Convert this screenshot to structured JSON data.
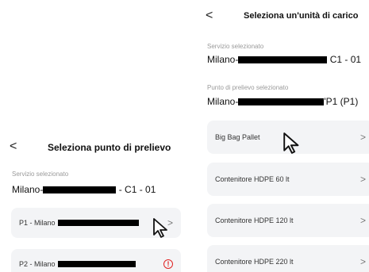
{
  "left": {
    "title": "Seleziona punto di prelievo",
    "back_glyph": "<",
    "service": {
      "label": "Servizio selezionato",
      "value_prefix": "Milano-",
      "value_suffix": " - C1 - 01"
    },
    "items": [
      {
        "label": "P1 - Milano",
        "chevron": ">"
      },
      {
        "label": "P2 - Milano",
        "alert": "!"
      }
    ]
  },
  "right": {
    "title": "Seleziona un'unità di carico",
    "back_glyph": "<",
    "service": {
      "label": "Servizio selezionato",
      "value_prefix": "Milano-",
      "value_suffix": " C1 - 01"
    },
    "pickup": {
      "label": "Punto di prelievo selezionato",
      "value_prefix": "Milano-",
      "value_suffix": "'P1 (P1)"
    },
    "items": [
      {
        "label": "Big Bag Pallet",
        "chevron": ">"
      },
      {
        "label": "Contenitore HDPE 60 lt",
        "chevron": ">"
      },
      {
        "label": "Contenitore HDPE 120 lt",
        "chevron": ">"
      },
      {
        "label": "Contenitore HDPE 220 lt",
        "chevron": ">"
      }
    ]
  },
  "icons": {
    "back": "chevron-left-icon",
    "chevron": "chevron-right-icon",
    "alert": "alert-circle-icon",
    "cursor": "mouse-pointer-icon"
  },
  "colors": {
    "item_background": "#f3f4f6",
    "alert": "#e02424",
    "label": "#9a9a9a"
  }
}
